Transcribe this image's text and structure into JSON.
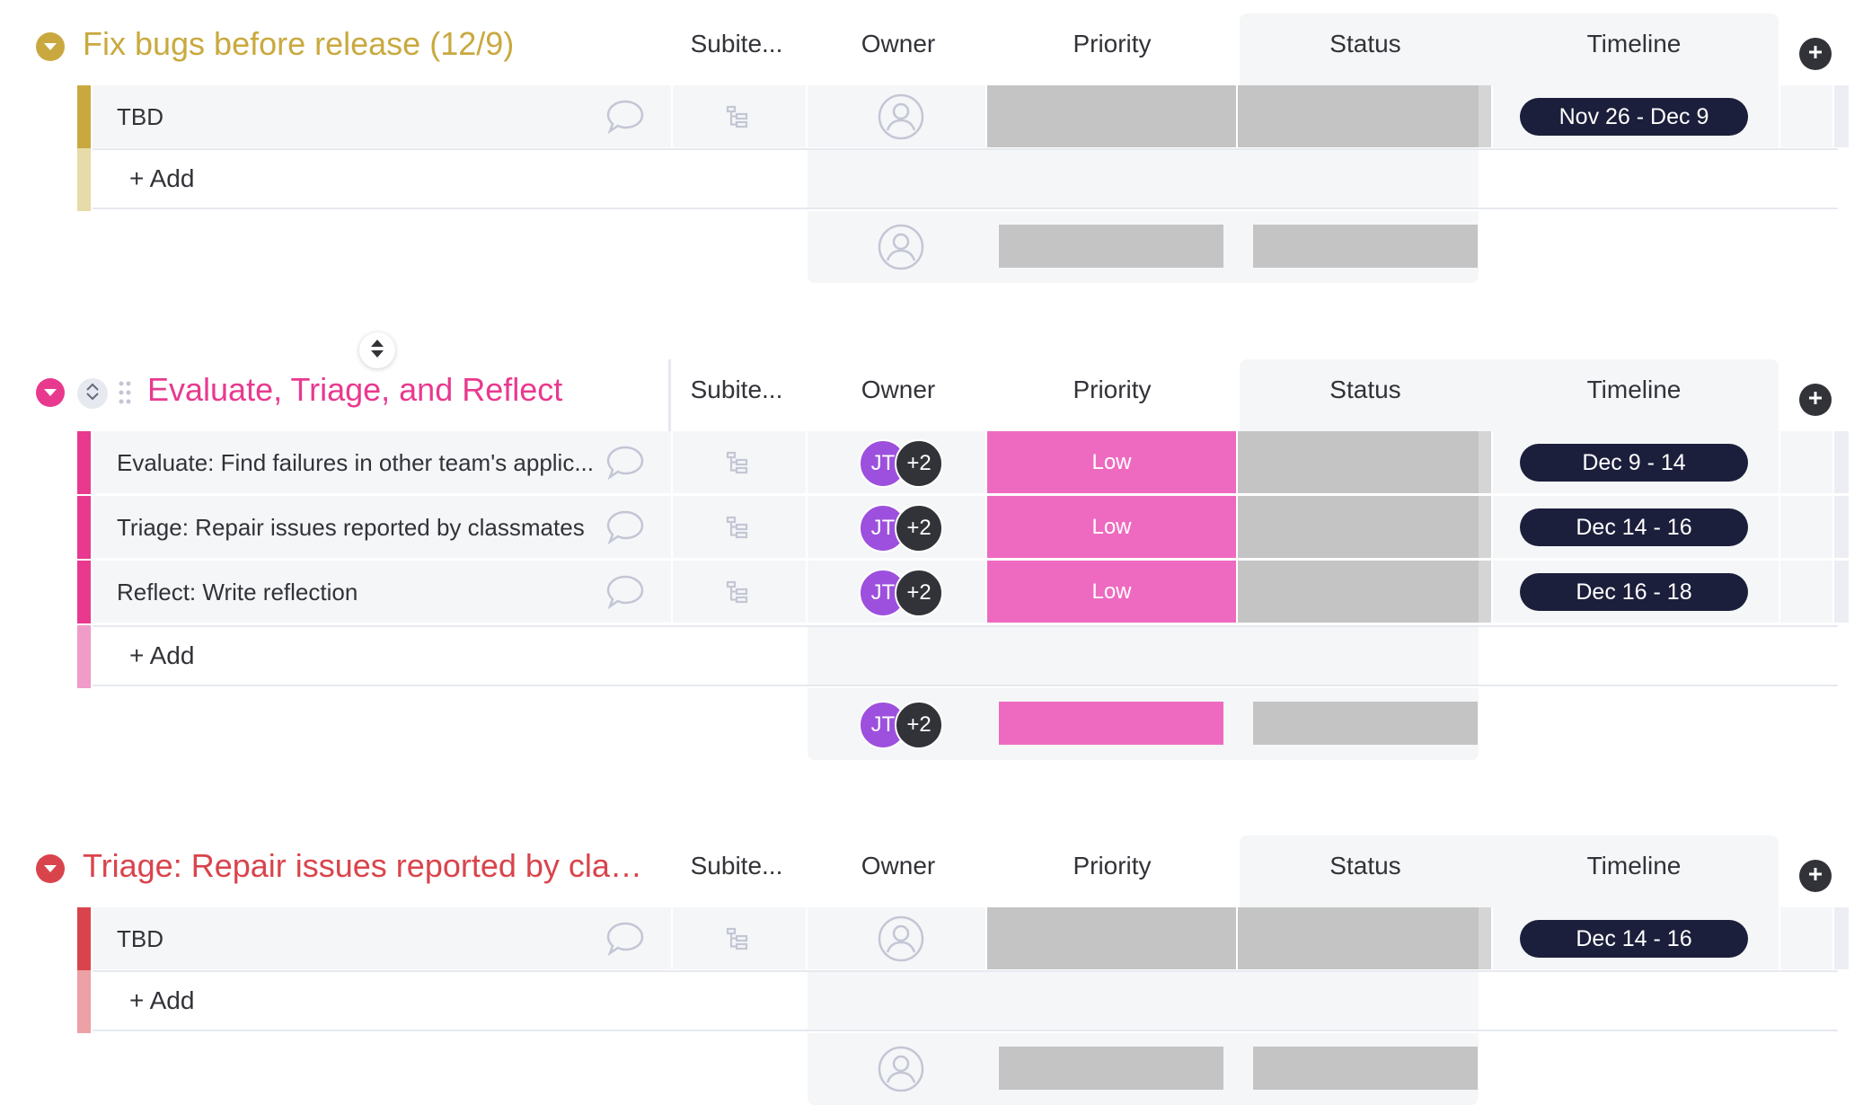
{
  "columns": {
    "subitems": "Subite...",
    "owner": "Owner",
    "priority": "Priority",
    "status": "Status",
    "timeline": "Timeline"
  },
  "add_item_label": "+ Add",
  "colors": {
    "group1": "#c9a93f",
    "group2": "#e8398f",
    "group3": "#d9444c",
    "priority_low": "#ee6ac0",
    "empty_cell": "#c4c4c4",
    "pill": "#1c1f3b"
  },
  "groups": [
    {
      "title": "Fix bugs before release (12/9)",
      "items": [
        {
          "name": "TBD",
          "priority": "",
          "timeline": "Nov 26 - Dec 9"
        }
      ]
    },
    {
      "title": "Evaluate, Triage, and Reflect",
      "items": [
        {
          "name": "Evaluate: Find failures in other team's applic...",
          "owner_initials": "JT",
          "owner_more": "+2",
          "priority": "Low",
          "timeline": "Dec 9 - 14"
        },
        {
          "name": "Triage: Repair issues reported by classmates",
          "owner_initials": "JT",
          "owner_more": "+2",
          "priority": "Low",
          "timeline": "Dec 14 - 16"
        },
        {
          "name": "Reflect: Write reflection",
          "owner_initials": "JT",
          "owner_more": "+2",
          "priority": "Low",
          "timeline": "Dec 16 - 18"
        }
      ],
      "summary_owner_initials": "JT",
      "summary_owner_more": "+2"
    },
    {
      "title": "Triage: Repair issues reported by class...",
      "items": [
        {
          "name": "TBD",
          "priority": "",
          "timeline": "Dec 14 - 16"
        }
      ]
    }
  ]
}
